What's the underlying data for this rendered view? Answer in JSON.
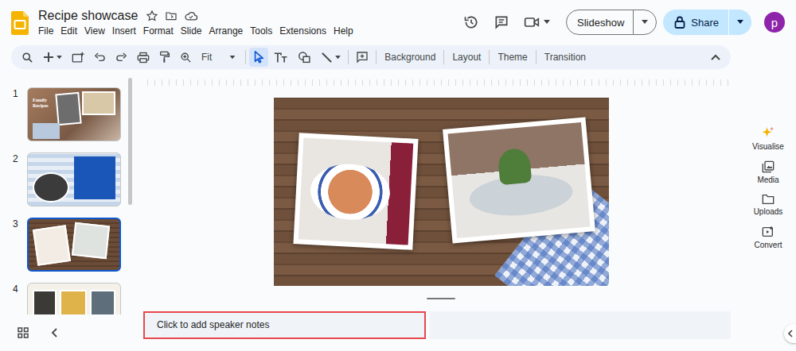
{
  "window": {
    "title": "Recipe showcase"
  },
  "menu": [
    "File",
    "Edit",
    "View",
    "Insert",
    "Format",
    "Slide",
    "Arrange",
    "Tools",
    "Extensions",
    "Help"
  ],
  "header": {
    "slideshow": "Slideshow",
    "share": "Share",
    "avatar": "p"
  },
  "toolbar": {
    "zoom": "Fit",
    "tools": [
      {
        "kind": "select",
        "selected": true
      },
      {
        "kind": "text",
        "selected": false
      },
      {
        "kind": "shape",
        "selected": false
      },
      {
        "kind": "line",
        "selected": false
      }
    ],
    "actions": [
      "Background",
      "Layout",
      "Theme",
      "Transition"
    ]
  },
  "slides": [
    {
      "number": "1",
      "selected": false,
      "kind": "cover",
      "title": "Family Recipes"
    },
    {
      "number": "2",
      "selected": false,
      "kind": "checked"
    },
    {
      "number": "3",
      "selected": true,
      "kind": "wood"
    },
    {
      "number": "4",
      "selected": false,
      "kind": "grid"
    }
  ],
  "notes": {
    "placeholder": "Click to add speaker notes"
  },
  "side_panel": [
    {
      "label": "Visualise",
      "kind": "sparkle"
    },
    {
      "label": "Media",
      "kind": "media"
    },
    {
      "label": "Uploads",
      "kind": "folder"
    },
    {
      "label": "Convert",
      "kind": "convert"
    }
  ]
}
